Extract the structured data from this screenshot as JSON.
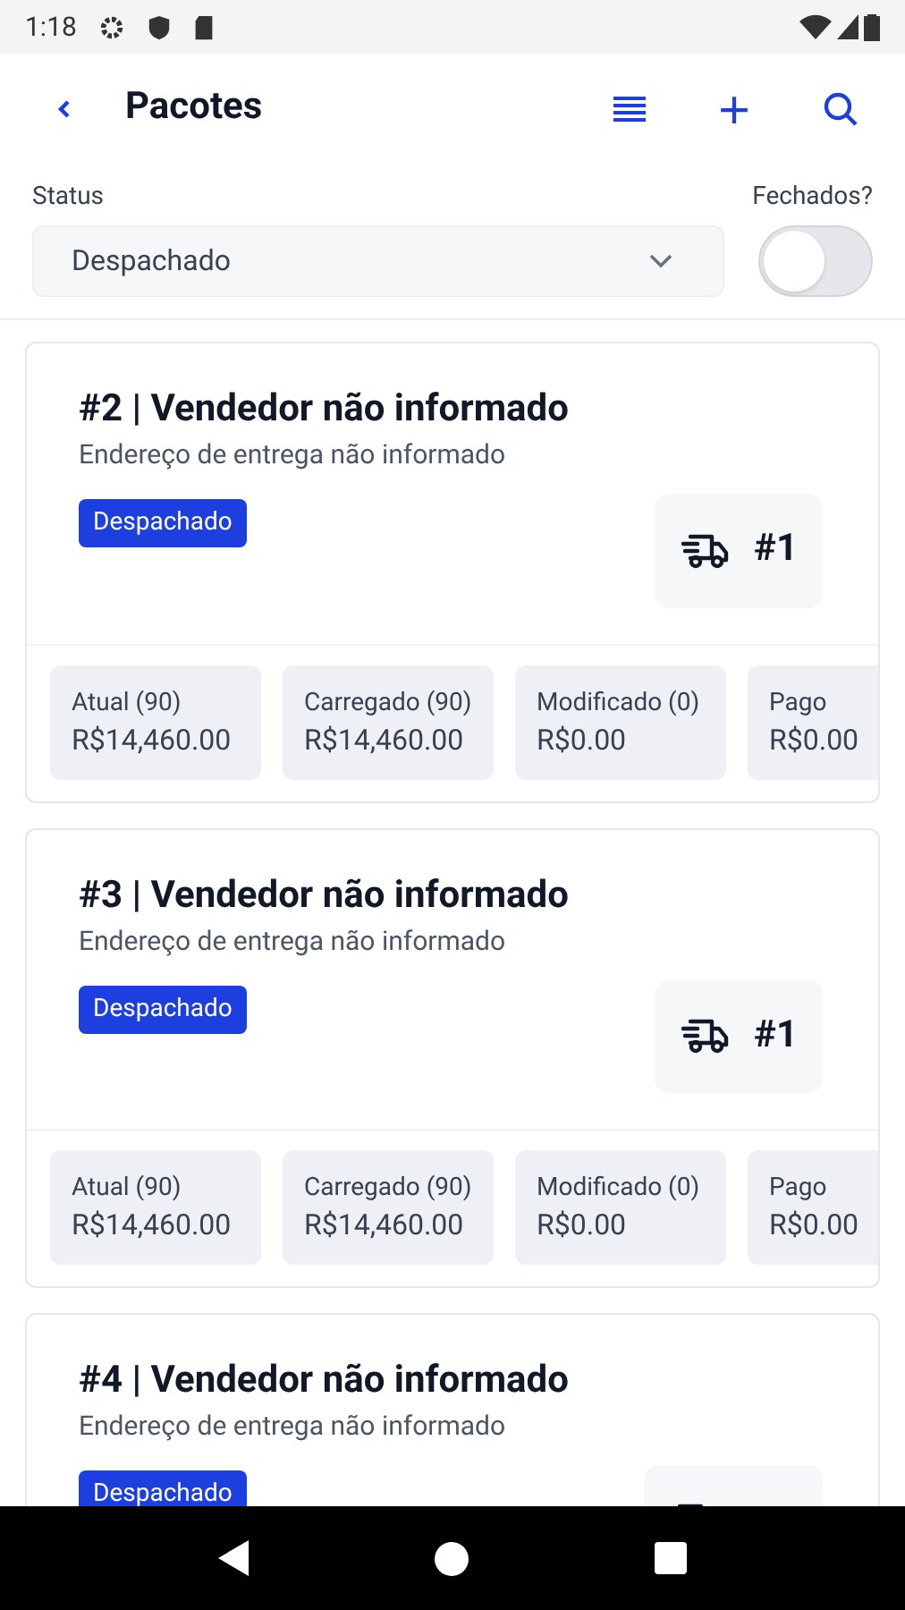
{
  "status_bar": {
    "time": "1:18"
  },
  "header": {
    "title": "Pacotes"
  },
  "filters": {
    "status_label": "Status",
    "status_value": "Despachado",
    "closed_label": "Fechados?",
    "closed_on": false
  },
  "packages": [
    {
      "title": "#2 | Vendedor não informado",
      "address": "Endereço de entrega não informado",
      "status": "Despachado",
      "vehicle": "#1",
      "totals": [
        {
          "label": "Atual (90)",
          "value": "R$14,460.00"
        },
        {
          "label": "Carregado (90)",
          "value": "R$14,460.00"
        },
        {
          "label": "Modificado (0)",
          "value": "R$0.00"
        },
        {
          "label": "Pago",
          "value": "R$0.00"
        }
      ]
    },
    {
      "title": "#3 | Vendedor não informado",
      "address": "Endereço de entrega não informado",
      "status": "Despachado",
      "vehicle": "#1",
      "totals": [
        {
          "label": "Atual (90)",
          "value": "R$14,460.00"
        },
        {
          "label": "Carregado (90)",
          "value": "R$14,460.00"
        },
        {
          "label": "Modificado (0)",
          "value": "R$0.00"
        },
        {
          "label": "Pago",
          "value": "R$0.00"
        }
      ]
    },
    {
      "title": "#4 | Vendedor não informado",
      "address": "Endereço de entrega não informado",
      "status": "Despachado"
    }
  ]
}
